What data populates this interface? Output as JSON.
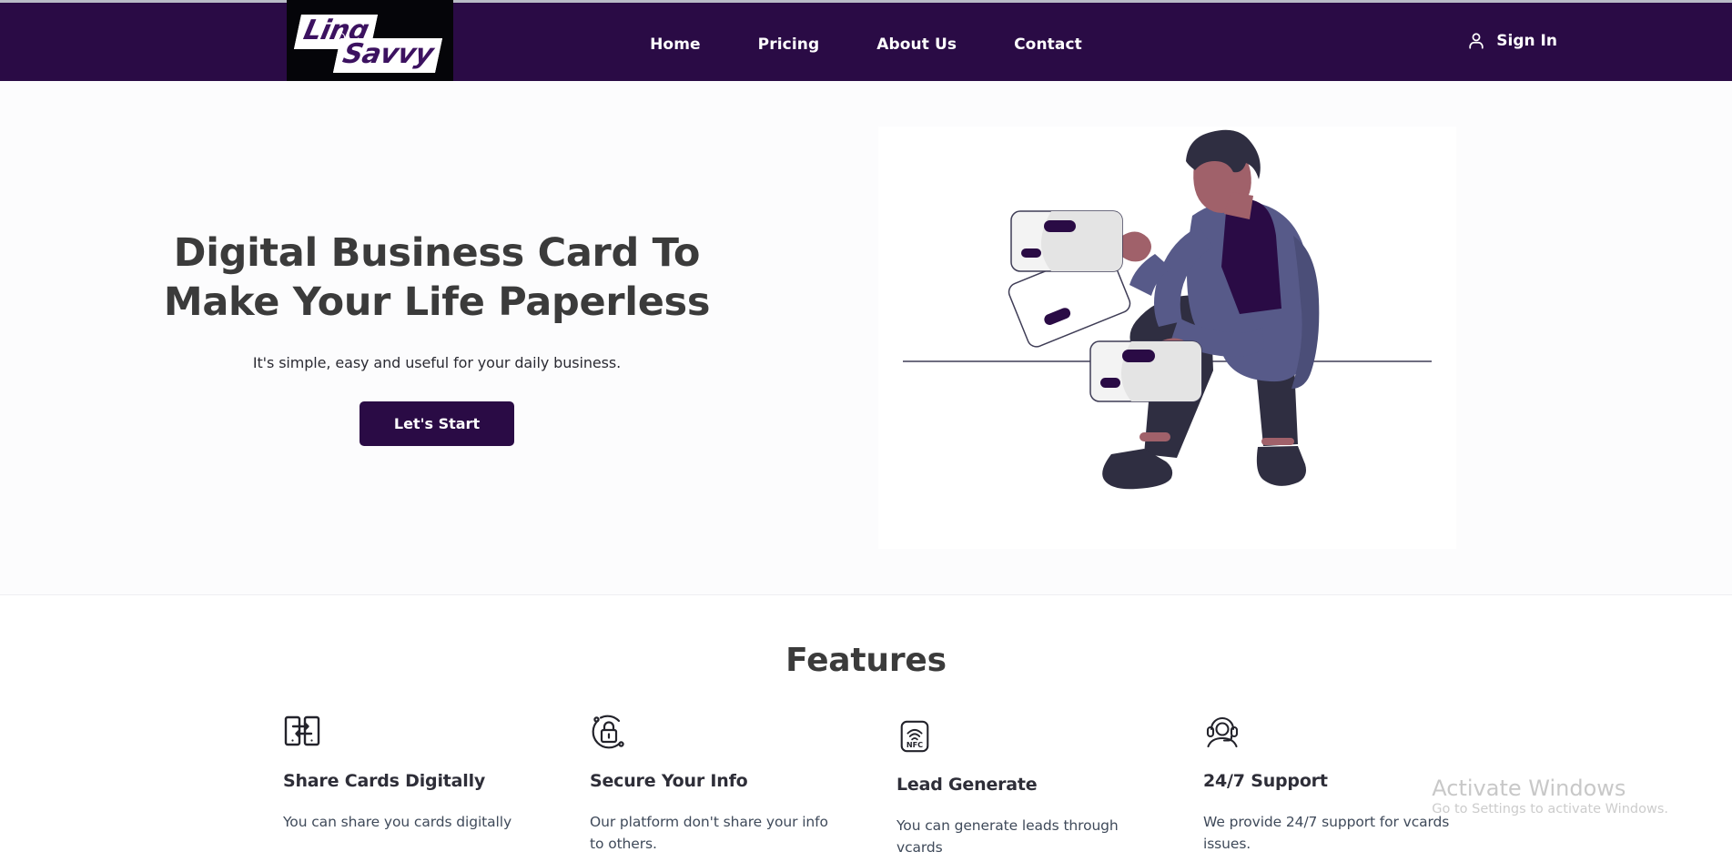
{
  "header": {
    "logo": {
      "line1": "Linq",
      "line2": "Savvy",
      "mark_icon": "registered-mark-icon"
    },
    "nav": [
      {
        "label": "Home"
      },
      {
        "label": "Pricing"
      },
      {
        "label": "About Us"
      },
      {
        "label": "Contact"
      }
    ],
    "signin": {
      "label": "Sign In",
      "icon": "user-icon"
    },
    "background_color": "#2a0b45"
  },
  "hero": {
    "title": "Digital Business Card To Make Your Life Paperless",
    "subtitle": "It's simple, easy and useful for your daily business.",
    "cta_label": "Let's Start",
    "cta_color": "#2a0b45",
    "illustration": "person-sitting-with-digital-cards-illustration",
    "background_color": "#fcfcfd"
  },
  "features": {
    "title": "Features",
    "items": [
      {
        "icon": "share-phones-icon",
        "name": "Share Cards Digitally",
        "desc": "You can share you cards digitally"
      },
      {
        "icon": "lock-orbit-icon",
        "name": "Secure Your Info",
        "desc": "Our platform don't share your info to others."
      },
      {
        "icon": "nfc-icon",
        "name": "Lead Generate",
        "desc": "You can generate leads through vcards"
      },
      {
        "icon": "headset-support-icon",
        "name": "24/7 Support",
        "desc": "We provide 24/7 support for vcards issues."
      }
    ]
  },
  "watermark": {
    "title": "Activate Windows",
    "subtitle": "Go to Settings to activate Windows."
  }
}
